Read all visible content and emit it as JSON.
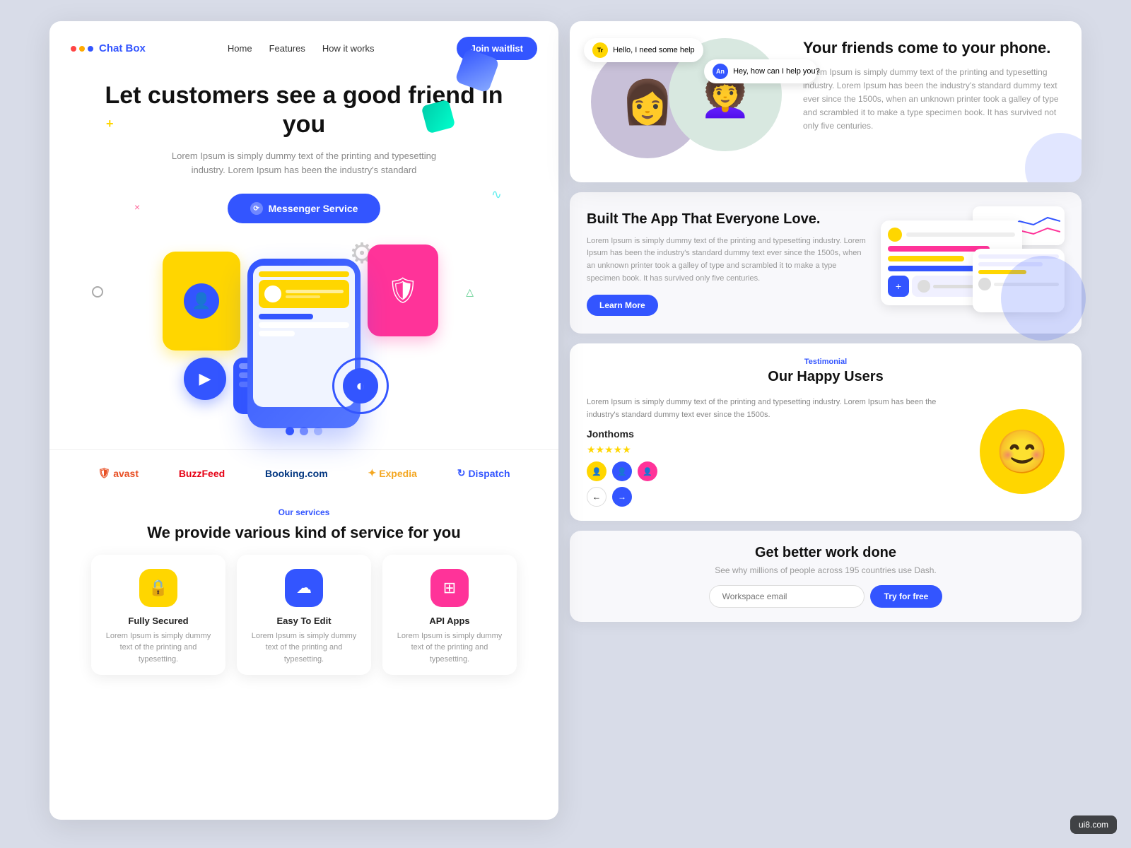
{
  "nav": {
    "logo_text": "Chat Box",
    "logo_dots": [
      "#ff4444",
      "#ffaa00",
      "#3355ff"
    ],
    "links": [
      "Home",
      "Features",
      "How it works"
    ],
    "cta": "Join waitlist"
  },
  "hero": {
    "title": "Let customers see a good friend in you",
    "subtitle": "Lorem Ipsum is simply dummy text of the printing and typesetting industry. Lorem Ipsum has been the industry's standard",
    "messenger_btn": "Messenger Service"
  },
  "brands": [
    {
      "name": "avast",
      "label": "avast",
      "icon": "🛡"
    },
    {
      "name": "buzzfeed",
      "label": "BuzzFeed",
      "icon": ""
    },
    {
      "name": "booking",
      "label": "Booking.com",
      "icon": ""
    },
    {
      "name": "expedia",
      "label": "Expedia",
      "icon": ""
    },
    {
      "name": "dispatch",
      "label": "Dispatch",
      "icon": ""
    }
  ],
  "services": {
    "tag": "Our services",
    "title": "We provide various kind of service for you",
    "cards": [
      {
        "icon": "🔒",
        "color": "yellow",
        "title": "Fully Secured",
        "desc": "Lorem Ipsum is simply dummy text of the printing and typesetting."
      },
      {
        "icon": "☁",
        "color": "blue",
        "title": "Easy To Edit",
        "desc": "Lorem Ipsum is simply dummy text of the printing and typesetting."
      },
      {
        "icon": "⊞",
        "color": "pink",
        "title": "API Apps",
        "desc": "Lorem Ipsum is simply dummy text of the printing and typesetting."
      }
    ]
  },
  "friends": {
    "heading": "Your friends come to your phone.",
    "desc": "Lorem Ipsum is simply dummy text of the printing and typesetting industry. Lorem Ipsum has been the industry's standard dummy text ever since the 1500s, when an unknown printer took a galley of type and scrambled it to make a type specimen book. It has survived not only five centuries.",
    "bubble1_name": "Tr",
    "bubble1_text": "Hello, I need some help",
    "bubble2_name": "An",
    "bubble2_text": "Hey, how can I help you?"
  },
  "app_section": {
    "heading": "Built The App That Everyone Love.",
    "desc": "Lorem Ipsum is simply dummy text of the printing and typesetting industry. Lorem Ipsum has been the industry's standard dummy text ever since the 1500s, when an unknown printer took a galley of type and scrambled it to make a type specimen book. It has survived only five centuries.",
    "btn": "Learn More"
  },
  "testimonial": {
    "tag": "Testimonial",
    "heading": "Our Happy Users",
    "text": "Lorem Ipsum is simply dummy text of the printing and typesetting industry. Lorem Ipsum has been the industry's standard dummy text ever since the 1500s.",
    "author": "Jonthoms",
    "nav_prev": "←",
    "nav_next": "→"
  },
  "work_section": {
    "heading": "Get better work done",
    "sub": "See why millions of people across 195 countries use Dash.",
    "placeholder": "Workspace email",
    "btn": "Try for free"
  },
  "watermark": "ui8.com"
}
